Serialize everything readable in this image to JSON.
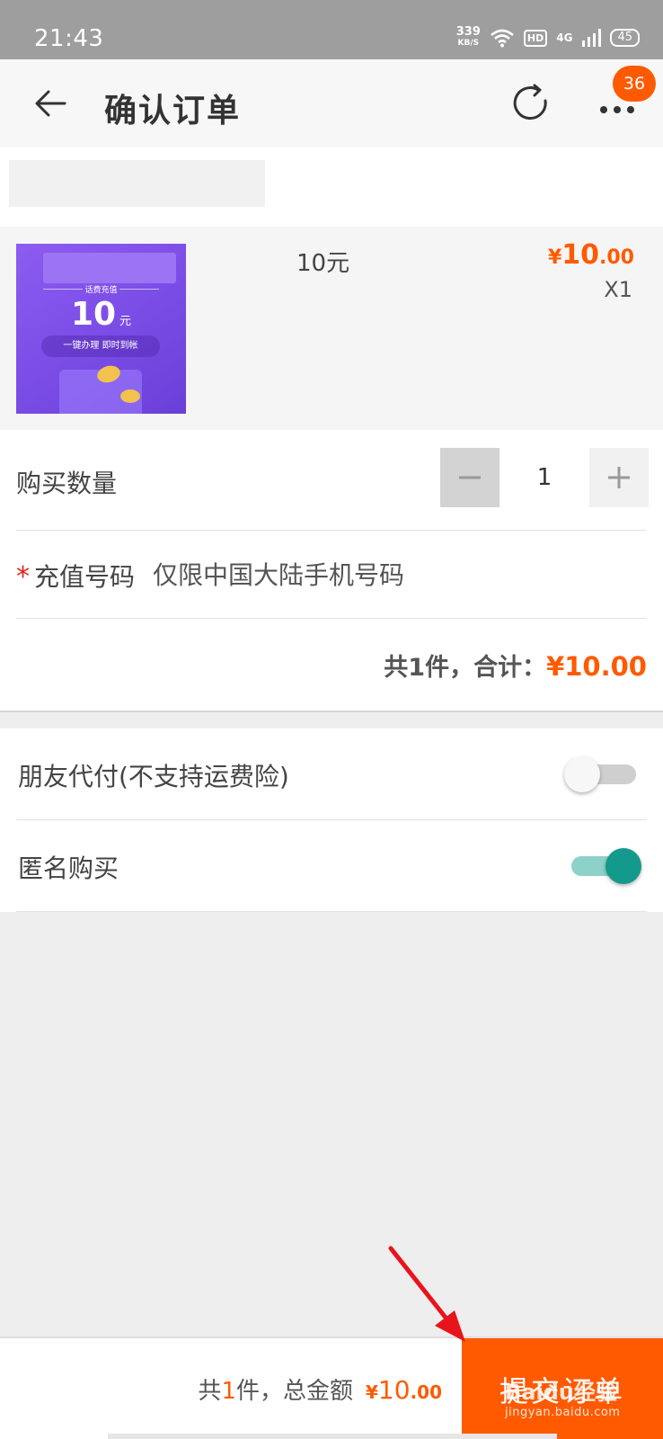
{
  "status_bar": {
    "time": "21:43",
    "speed_value": "339",
    "speed_unit": "KB/S",
    "hd_label": "HD",
    "network_label": "4G",
    "battery": "45"
  },
  "header": {
    "title": "确认订单",
    "badge_count": "36",
    "back_icon": "arrow-left-icon",
    "refresh_icon": "refresh-icon",
    "more_icon": "more-dots-icon"
  },
  "product": {
    "image_title": "话费充值",
    "image_amount": "10",
    "image_unit": "元",
    "image_tagline": "一键办理 即时到帐",
    "name": "10元",
    "price_symbol": "¥",
    "price_int": "10",
    "price_dec": ".00",
    "quantity_text": "X1"
  },
  "order_form": {
    "quantity_label": "购买数量",
    "quantity_value": "1",
    "minus_symbol": "−",
    "plus_symbol": "+",
    "required_mark": "*",
    "phone_label": "充值号码",
    "phone_placeholder": "仅限中国大陆手机号码",
    "subtotal_prefix": "共1件，合计：",
    "subtotal_amount": "¥10.00"
  },
  "options": [
    {
      "label": "朋友代付(不支持运费险)",
      "enabled": false
    },
    {
      "label": "匿名购买",
      "enabled": true
    }
  ],
  "footer": {
    "summary_prefix": "共",
    "summary_count": "1",
    "summary_suffix": "件，总金额",
    "total_symbol": "¥",
    "total_int": "10",
    "total_dec": ".00",
    "submit_label": "提交订单"
  },
  "watermark": {
    "brand": "Baidu经验",
    "url": "jingyan.baidu.com"
  },
  "colors": {
    "accent": "#ff5a00",
    "toggle_on": "#139a8c",
    "arrow": "#e8141c"
  }
}
